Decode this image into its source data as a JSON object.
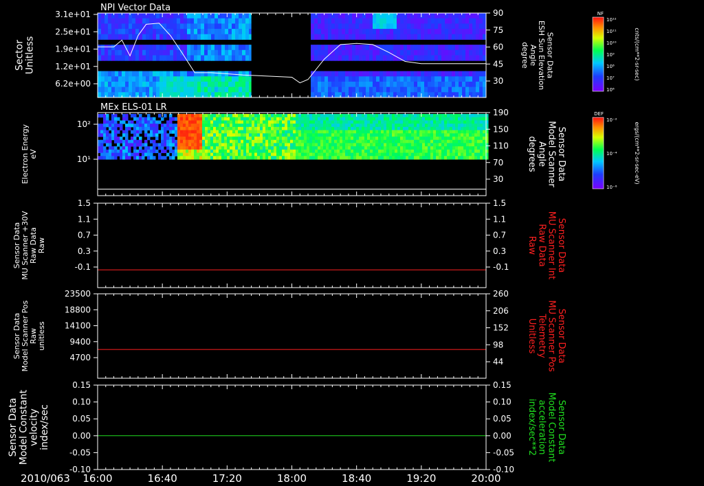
{
  "date_label": "2010/063",
  "time_ticks": [
    "16:00",
    "16:40",
    "17:20",
    "18:00",
    "18:40",
    "19:20",
    "20:00"
  ],
  "colors": {
    "background": "#000000",
    "axis": "#ffffff",
    "red_trace": "#ff2020",
    "green_trace": "#20e020",
    "red_label": "#ff2020",
    "green_label": "#20e020"
  },
  "colorbars": [
    {
      "tag": "NF",
      "unit": "cnts/(cm**2-sr-sec)",
      "tick_labels": [
        "10¹²",
        "10¹¹",
        "10¹⁰",
        "10⁹",
        "10⁸",
        "10⁷",
        "10⁶"
      ]
    },
    {
      "tag": "DEF",
      "unit": "ergs/(cm**2-sr-sec-eV)",
      "tick_labels": [
        "10⁻²",
        "10⁻⁴",
        "10⁻⁶"
      ]
    }
  ],
  "chart_data": [
    {
      "type": "heatmap",
      "title": "NPI Vector Data",
      "ylabel": [
        "Sector",
        "Unitless"
      ],
      "ytick_labels": [
        "3.1e+01",
        "2.5e+01",
        "1.9e+01",
        "1.2e+01",
        "6.2e+00"
      ],
      "right_ylabel": [
        "Sensor Data",
        "ESH Sun Elevation",
        "Angle",
        "degree"
      ],
      "right_ytick_labels": [
        "90",
        "75",
        "60",
        "45",
        "30"
      ],
      "right_ylim": [
        15,
        90
      ],
      "overlay_line": {
        "x": [
          "16:00",
          "16:10",
          "16:15",
          "16:20",
          "16:25",
          "16:30",
          "16:38",
          "16:45",
          "16:52",
          "17:00",
          "17:10",
          "17:20",
          "17:30",
          "17:45",
          "18:00",
          "18:05",
          "18:10",
          "18:20",
          "18:30",
          "18:40",
          "18:50",
          "19:00",
          "19:10",
          "19:20",
          "19:30",
          "19:40",
          "20:00"
        ],
        "y": [
          60,
          60,
          66,
          52,
          70,
          80,
          81,
          70,
          55,
          37,
          37,
          36,
          35,
          34,
          33,
          28,
          31,
          49,
          62,
          63,
          62,
          55,
          47,
          45,
          45,
          45,
          45
        ]
      },
      "gap": [
        "17:35",
        "18:10"
      ]
    },
    {
      "type": "heatmap",
      "title": "MEx ELS-01 LR",
      "ylabel": [
        "Electron Energy",
        "eV"
      ],
      "ytick_labels": [
        "10²",
        "10¹"
      ],
      "right_ylabel": [
        "Sensor Data",
        "Model Scanner",
        "Angle",
        "degrees"
      ],
      "right_ytick_labels": [
        "190",
        "150",
        "110",
        "70",
        "30"
      ],
      "right_ylim": [
        0,
        190
      ],
      "overlay_line": {
        "y": 15
      }
    },
    {
      "type": "line",
      "ylabel": [
        "Sensor Data",
        "MU Scanner +30V",
        "Raw Data",
        "Raw"
      ],
      "ytick_labels": [
        "1.5",
        "1.1",
        "0.7",
        "0.3",
        "-0.1"
      ],
      "ylim": [
        -0.4,
        1.5
      ],
      "right_ylabel": [
        "Sensor Data",
        "MU Scanner Int",
        "Raw Data",
        "Raw"
      ],
      "right_ytick_labels": [
        "1.5",
        "1.1",
        "0.7",
        "0.3",
        "-0.1"
      ],
      "series": [
        {
          "values": [
            0.0,
            0.0
          ]
        }
      ],
      "x": [
        "16:00",
        "20:00"
      ]
    },
    {
      "type": "line",
      "ylabel": [
        "Sensor Data",
        "Model Scanner Pos",
        "Raw",
        "unitless"
      ],
      "ytick_labels": [
        "23500",
        "18800",
        "14100",
        "9400",
        "4700"
      ],
      "ylim": [
        0,
        23500
      ],
      "right_ylabel": [
        "Sensor Data",
        "MU Scanner Pos",
        "Telemetry",
        "Unitless"
      ],
      "right_ytick_labels": [
        "260",
        "206",
        "152",
        "98",
        "44"
      ],
      "series": [
        {
          "values": [
            8000,
            8000
          ]
        }
      ],
      "x": [
        "16:00",
        "20:00"
      ]
    },
    {
      "type": "line",
      "ylabel": [
        "Sensor Data",
        "Model Constant",
        "velocity",
        "index/sec"
      ],
      "ytick_labels": [
        "0.15",
        "0.10",
        "0.05",
        "0.00",
        "-0.05",
        "-0.10"
      ],
      "ylim": [
        -0.1,
        0.15
      ],
      "right_ylabel": [
        "Sensor Data",
        "Model Constant",
        "acceleration",
        "index/sec**2"
      ],
      "right_ytick_labels": [
        "0.15",
        "0.10",
        "0.05",
        "0.00",
        "-0.05",
        "-0.10"
      ],
      "series": [
        {
          "values": [
            0.0,
            0.0
          ]
        }
      ],
      "x": [
        "16:00",
        "20:00"
      ]
    }
  ]
}
